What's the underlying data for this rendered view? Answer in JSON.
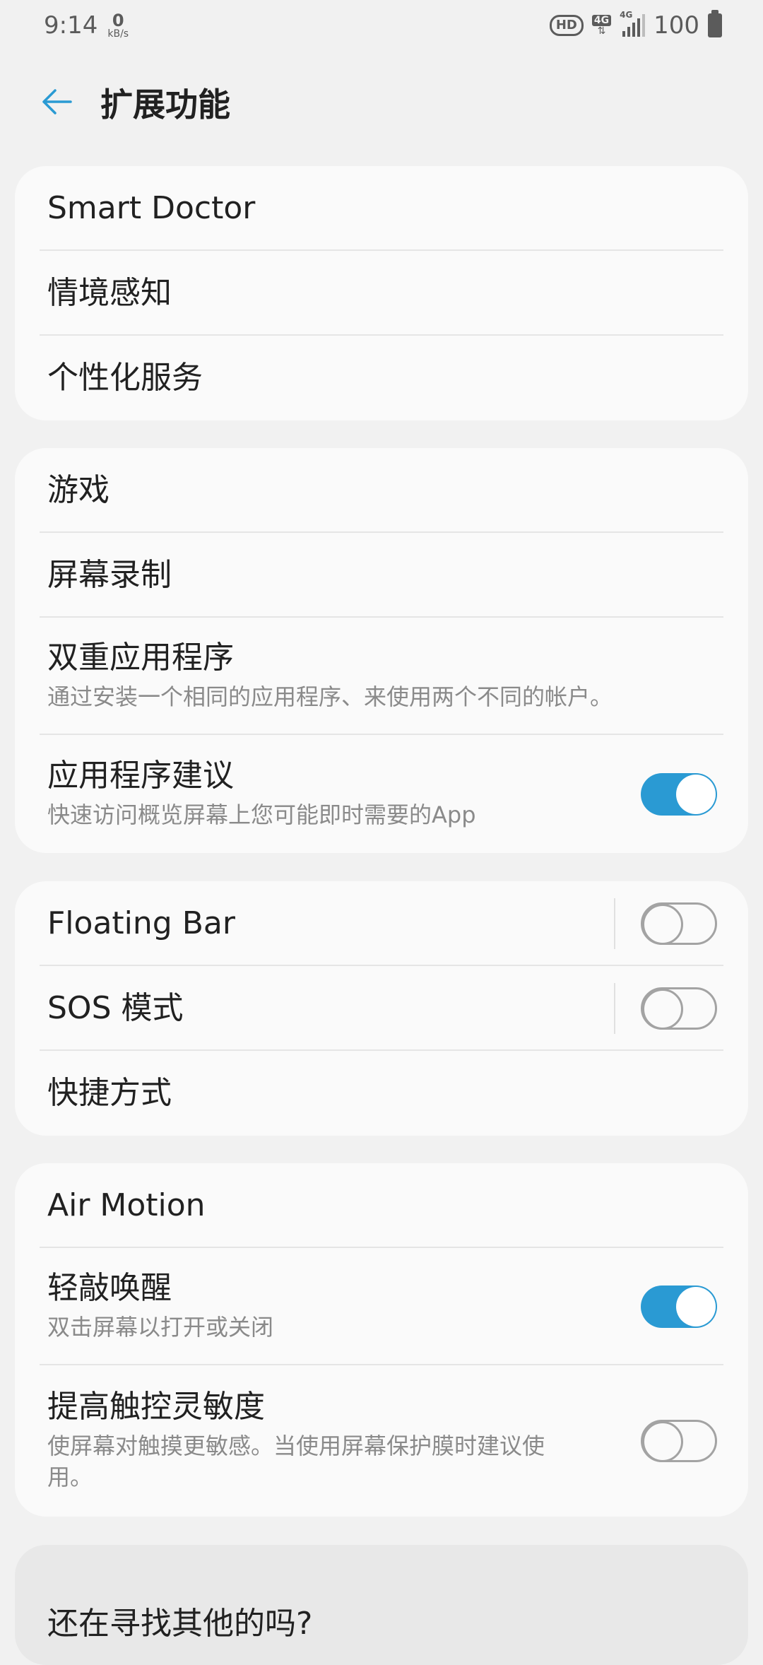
{
  "status_bar": {
    "time": "9:14",
    "net_speed_value": "0",
    "net_speed_unit": "kB/s",
    "hd_badge": "HD",
    "network_a": "4G",
    "network_b": "4G",
    "battery_level": "100",
    "icons": [
      "hd-icon",
      "4g-data-icon",
      "signal-icon",
      "battery-icon"
    ]
  },
  "header": {
    "title": "扩展功能",
    "back_icon": "arrow-left-icon"
  },
  "sections": [
    {
      "items": [
        {
          "title": "Smart Doctor"
        },
        {
          "title": "情境感知"
        },
        {
          "title": "个性化服务"
        }
      ]
    },
    {
      "items": [
        {
          "title": "游戏"
        },
        {
          "title": "屏幕录制"
        },
        {
          "title": "双重应用程序",
          "subtitle": "通过安装一个相同的应用程序、来使用两个不同的帐户。"
        },
        {
          "title": "应用程序建议",
          "subtitle": "快速访问概览屏幕上您可能即时需要的App",
          "toggle": "on"
        }
      ]
    },
    {
      "items": [
        {
          "title": "Floating Bar",
          "toggle": "off"
        },
        {
          "title": "SOS 模式",
          "toggle": "off"
        },
        {
          "title": "快捷方式"
        }
      ]
    },
    {
      "items": [
        {
          "title": "Air Motion"
        },
        {
          "title": "轻敲唤醒",
          "subtitle": "双击屏幕以打开或关闭",
          "toggle": "on"
        },
        {
          "title": "提高触控灵敏度",
          "subtitle_line1": "使屏幕对触摸更敏感。当使用屏幕保护膜时建议使",
          "subtitle_line2": "用。",
          "toggle": "off"
        }
      ]
    }
  ],
  "bottom_prompt": "还在寻找其他的吗?",
  "colors": {
    "accent": "#2a9ad3",
    "background": "#f1f1f1",
    "card": "#fafafa",
    "subtitle": "#8a8a8a"
  }
}
